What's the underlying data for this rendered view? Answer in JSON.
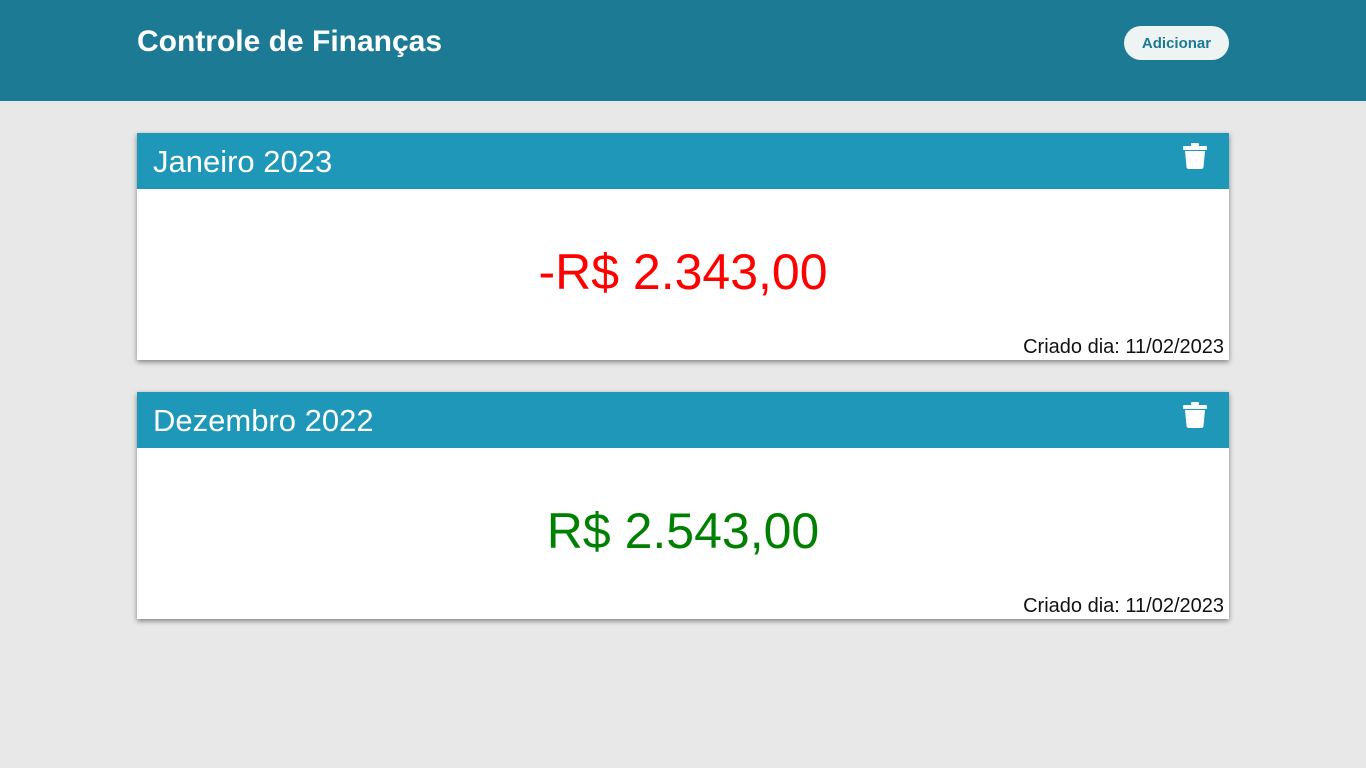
{
  "header": {
    "title": "Controle de Finanças",
    "add_label": "Adicionar",
    "background": "#1c7a94"
  },
  "cards": [
    {
      "month": "Janeiro 2023",
      "amount": "-R$ 2.343,00",
      "amount_color": "#ff0000",
      "created": "Criado dia: 11/02/2023",
      "delete_icon": "trash-icon"
    },
    {
      "month": "Dezembro 2022",
      "amount": "R$ 2.543,00",
      "amount_color": "#008000",
      "created": "Criado dia: 11/02/2023",
      "delete_icon": "trash-icon"
    }
  ],
  "colors": {
    "card_header": "#1e97b8",
    "page_background": "#e8e8e8"
  }
}
